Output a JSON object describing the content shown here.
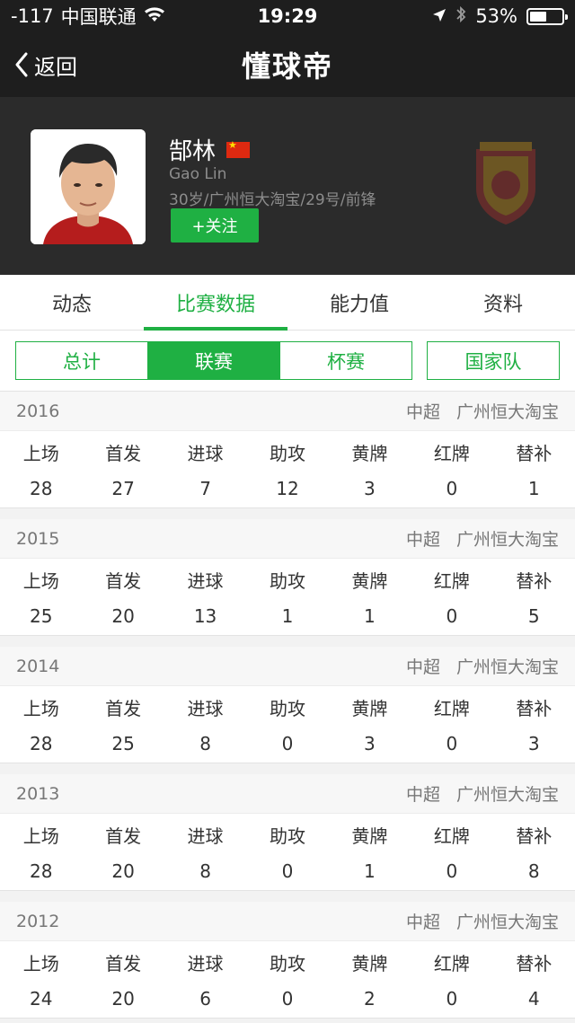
{
  "status": {
    "signal": "-117",
    "carrier": "中国联通",
    "time": "19:29",
    "battery": "53%",
    "battery_fraction": 0.53
  },
  "nav": {
    "back_label": "返回",
    "title": "懂球帝"
  },
  "player": {
    "name_cn": "郜林",
    "name_en": "Gao Lin",
    "info": "30岁/广州恒大淘宝/29号/前锋",
    "follow_label": "+关注"
  },
  "tabs": [
    {
      "label": "动态"
    },
    {
      "label": "比赛数据"
    },
    {
      "label": "能力值"
    },
    {
      "label": "资料"
    }
  ],
  "segments": [
    {
      "label": "总计"
    },
    {
      "label": "联赛"
    },
    {
      "label": "杯赛"
    },
    {
      "label": "国家队"
    }
  ],
  "stat_labels": [
    "上场",
    "首发",
    "进球",
    "助攻",
    "黄牌",
    "红牌",
    "替补"
  ],
  "seasons": [
    {
      "year": "2016",
      "league": "中超",
      "team": "广州恒大淘宝",
      "values": [
        "28",
        "27",
        "7",
        "12",
        "3",
        "0",
        "1"
      ]
    },
    {
      "year": "2015",
      "league": "中超",
      "team": "广州恒大淘宝",
      "values": [
        "25",
        "20",
        "13",
        "1",
        "1",
        "0",
        "5"
      ]
    },
    {
      "year": "2014",
      "league": "中超",
      "team": "广州恒大淘宝",
      "values": [
        "28",
        "25",
        "8",
        "0",
        "3",
        "0",
        "3"
      ]
    },
    {
      "year": "2013",
      "league": "中超",
      "team": "广州恒大淘宝",
      "values": [
        "28",
        "20",
        "8",
        "0",
        "1",
        "0",
        "8"
      ]
    },
    {
      "year": "2012",
      "league": "中超",
      "team": "广州恒大淘宝",
      "values": [
        "24",
        "20",
        "6",
        "0",
        "2",
        "0",
        "4"
      ]
    }
  ],
  "colors": {
    "accent": "#1fb043",
    "header_bg": "#1e1e1e",
    "profile_bg": "#2b2b2b"
  }
}
